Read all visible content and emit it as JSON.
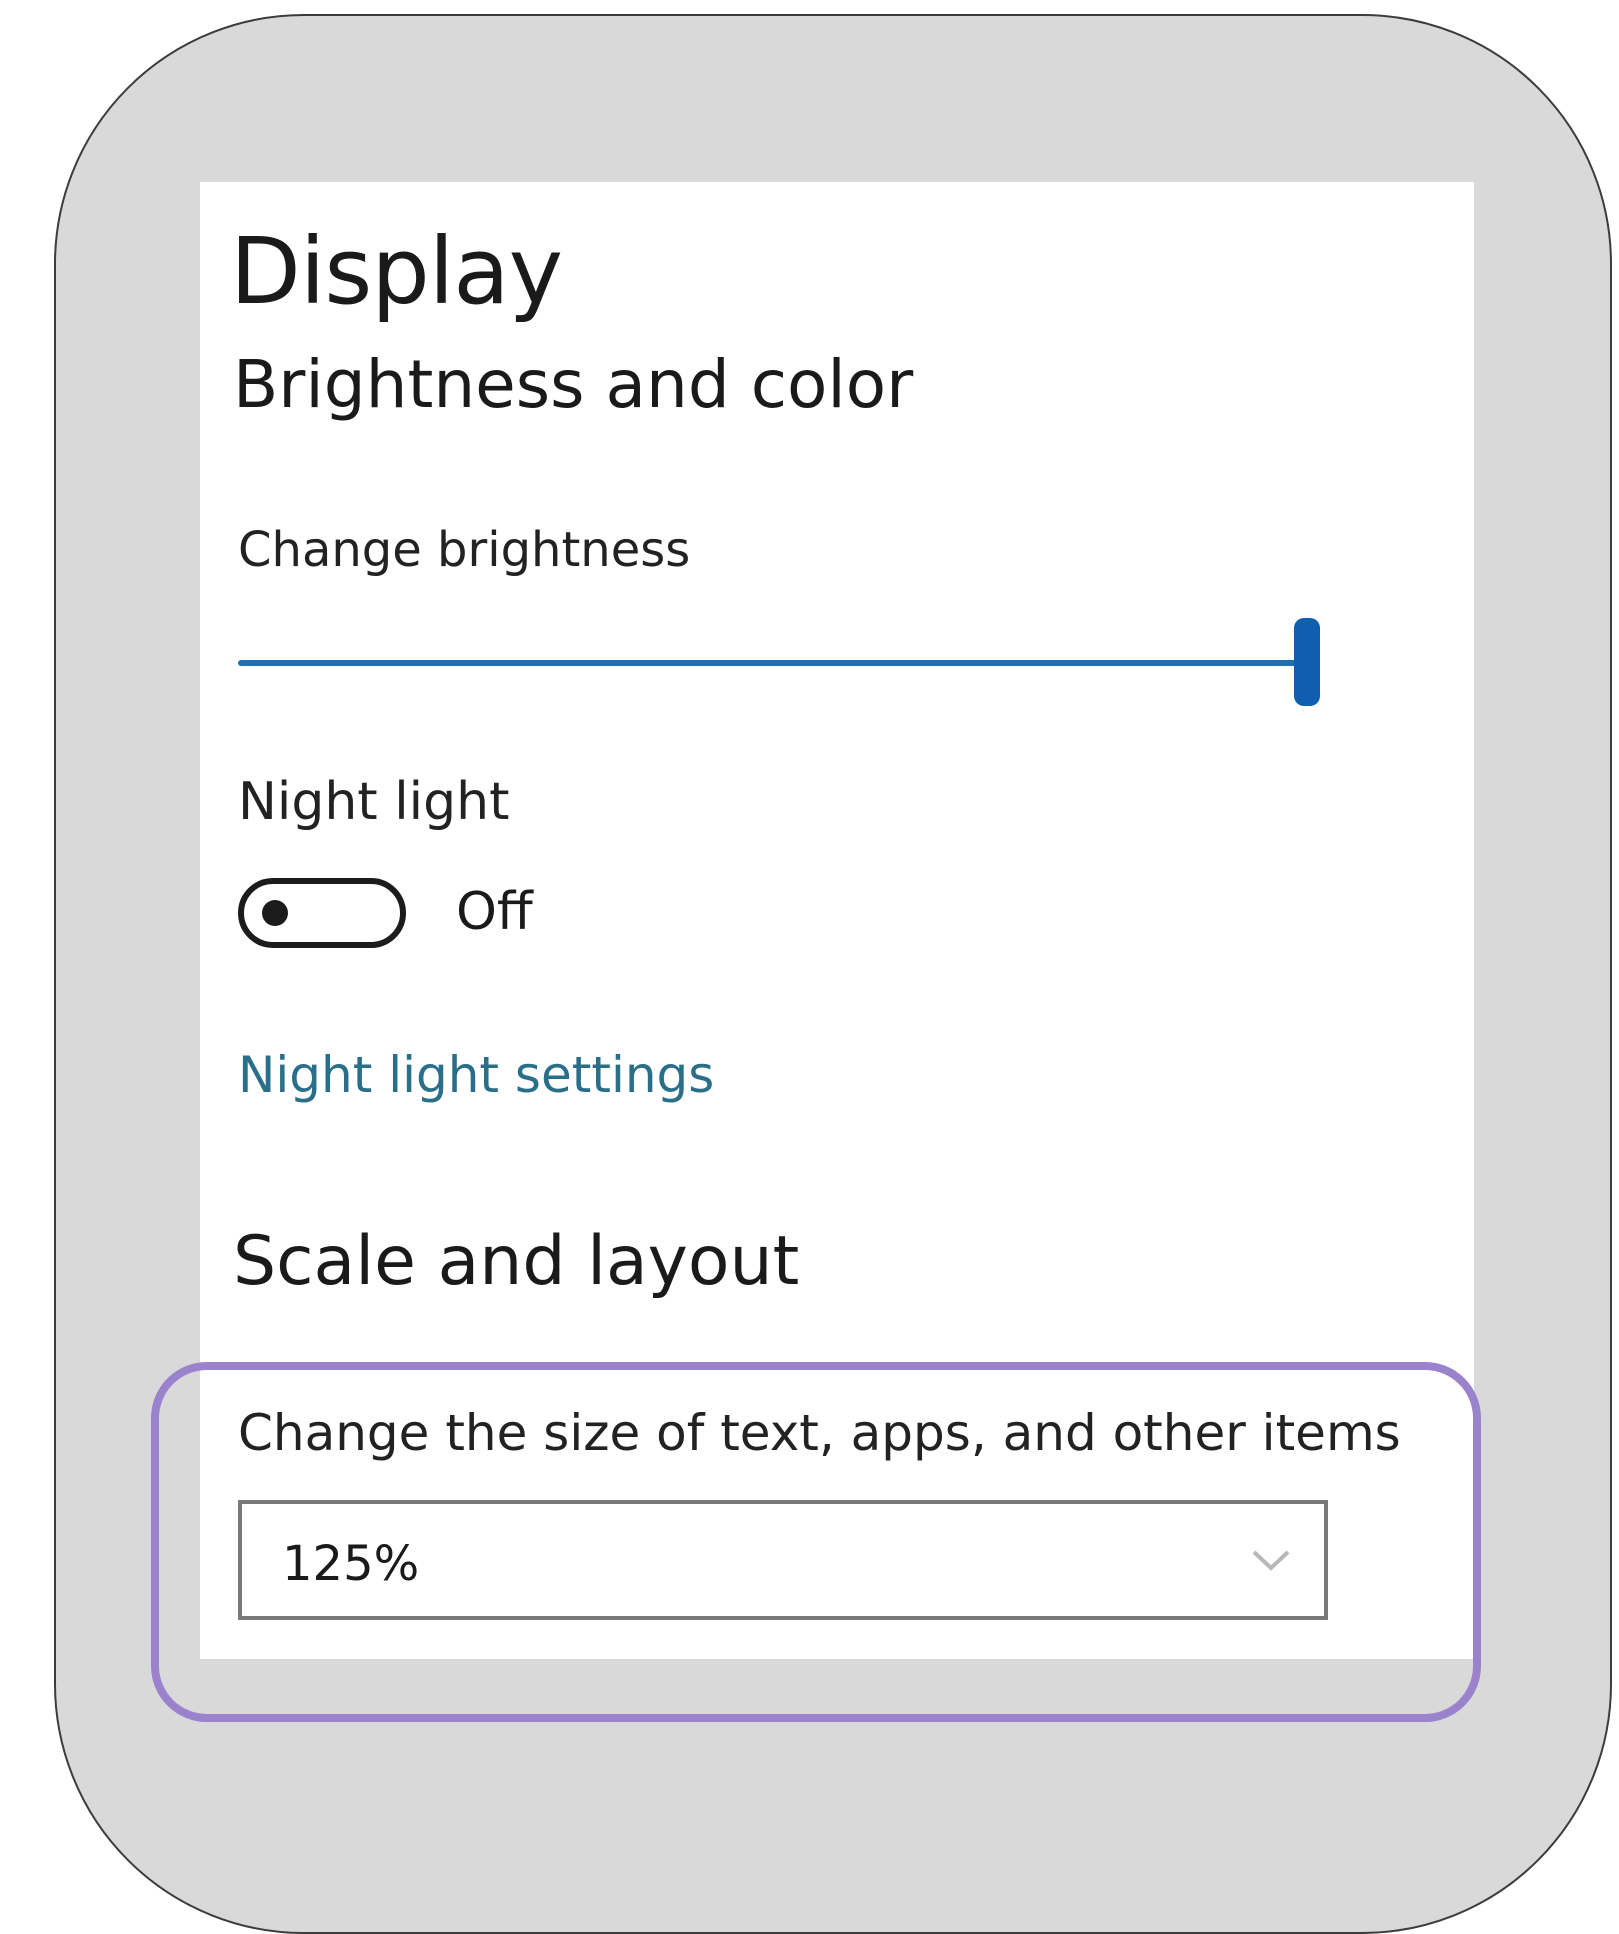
{
  "page": {
    "title": "Display"
  },
  "brightness": {
    "section_title": "Brightness and color",
    "label": "Change brightness",
    "level": 1.0
  },
  "night_light": {
    "label": "Night light",
    "state": "Off",
    "settings_link": "Night light settings"
  },
  "scale": {
    "section_title": "Scale and layout",
    "label": "Change the size of text, apps, and other items",
    "selected": "125%"
  },
  "icons": {
    "dropdown": "chevron-down-icon"
  },
  "colors": {
    "accent": "#0f5fae",
    "link": "#2a6f8a",
    "highlight": "#9a82cc"
  }
}
